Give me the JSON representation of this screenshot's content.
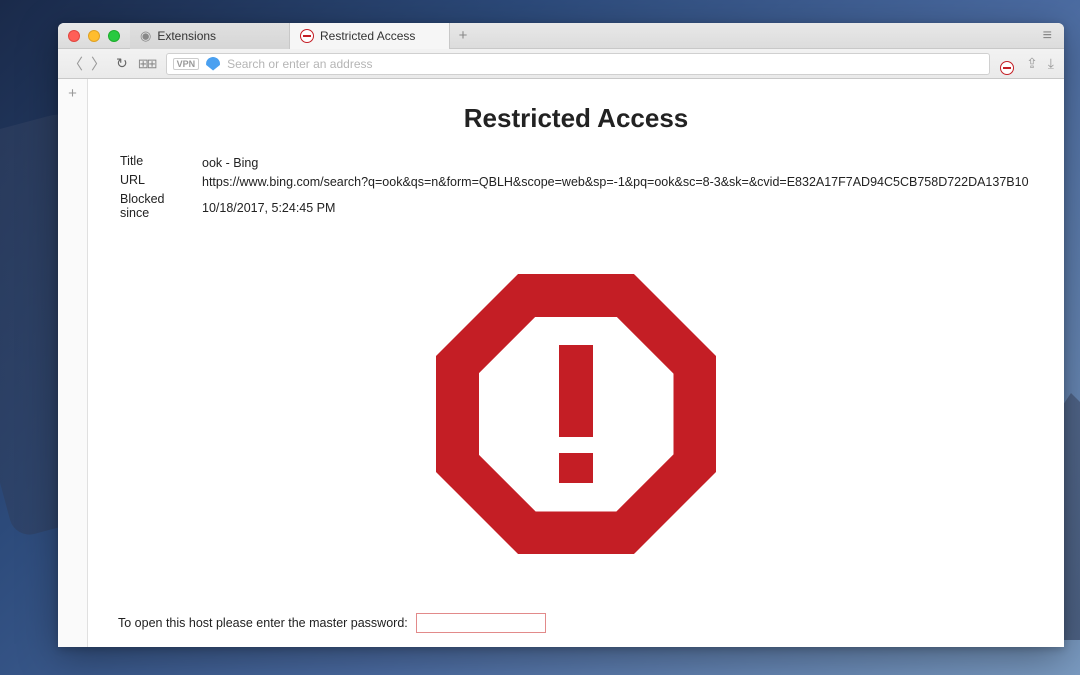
{
  "tabs": {
    "inactive_label": "Extensions",
    "active_label": "Restricted Access"
  },
  "address_bar": {
    "vpn_label": "VPN",
    "placeholder": "Search or enter an address",
    "value": ""
  },
  "page": {
    "title": "Restricted Access",
    "labels": {
      "title": "Title",
      "url": "URL",
      "blocked_since": "Blocked since"
    },
    "values": {
      "title": "ook - Bing",
      "url": "https://www.bing.com/search?q=ook&qs=n&form=QBLH&scope=web&sp=-1&pq=ook&sc=8-3&sk=&cvid=E832A17F7AD94C5CB758D722DA137B10",
      "blocked_since": "10/18/2017, 5:24:45 PM"
    },
    "password_prompt": "To open this host please enter the master password:"
  },
  "colors": {
    "stop_red": "#c41e25"
  }
}
